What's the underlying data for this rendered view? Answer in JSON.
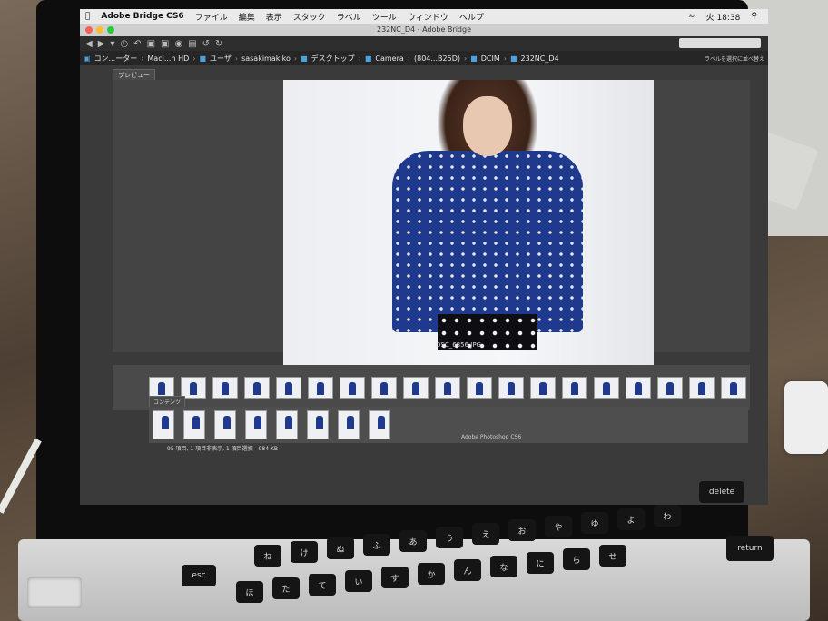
{
  "menubar": {
    "app": "Adobe Bridge CS6",
    "menus": [
      "ファイル",
      "編集",
      "表示",
      "スタック",
      "ラベル",
      "ツール",
      "ウィンドウ",
      "ヘルプ"
    ],
    "clock": "火 18:38"
  },
  "window": {
    "title": "232NC_D4 - Adobe Bridge"
  },
  "pathbar": {
    "crumbs": [
      "コン...ーター",
      "Maci...h HD",
      "ユーザ",
      "sasakimakiko",
      "デスクトップ",
      "Camera",
      "(804...B25D)",
      "DCIM",
      "232NC_D4"
    ],
    "label_select": "ラベルを選択に並べ替え"
  },
  "panels": {
    "preview_tab": "プレビュー",
    "content_tab": "コンテンツ"
  },
  "preview": {
    "filename": "DSC_6856.JPG"
  },
  "status": {
    "text": "95 項目, 1 項目非表示, 1 項目選択 - 984 KB"
  },
  "caption": {
    "text": "Adobe Photoshop CS6"
  },
  "keyboard": {
    "keys": [
      "esc",
      "delete",
      "return",
      "ね",
      "け",
      "ぬ",
      "ふ",
      "あ",
      "う",
      "え",
      "お",
      "や",
      "ゆ",
      "よ",
      "わ",
      "ほ",
      "た",
      "て",
      "い",
      "す",
      "か",
      "ん",
      "な",
      "に",
      "ら",
      "せ"
    ]
  },
  "colors": {
    "accent": "#4aa3df",
    "shirt": "#1f3a8c"
  }
}
